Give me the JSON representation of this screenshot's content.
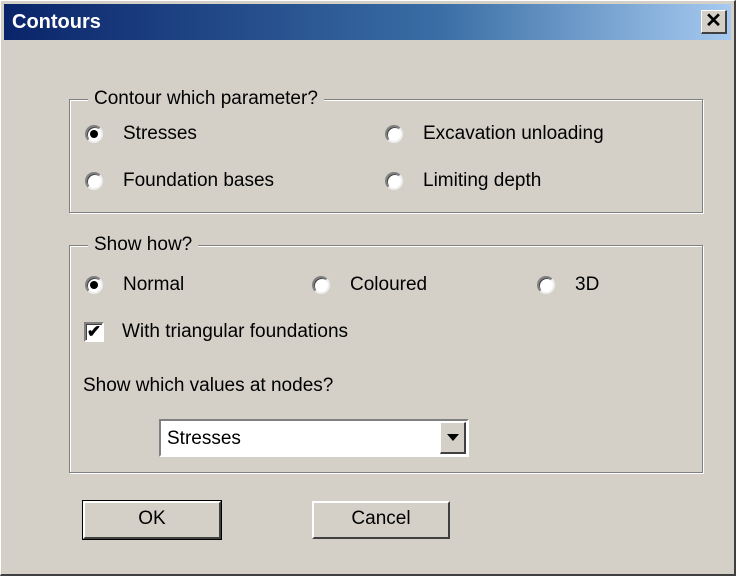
{
  "window": {
    "title": "Contours",
    "close_label": "✕"
  },
  "parameter_group": {
    "legend": "Contour which parameter?",
    "options": [
      {
        "label": "Stresses",
        "selected": true
      },
      {
        "label": "Excavation unloading",
        "selected": false
      },
      {
        "label": "Foundation bases",
        "selected": false
      },
      {
        "label": "Limiting depth",
        "selected": false
      }
    ]
  },
  "show_group": {
    "legend": "Show how?",
    "options": [
      {
        "label": "Normal",
        "selected": true
      },
      {
        "label": "Coloured",
        "selected": false
      },
      {
        "label": "3D",
        "selected": false
      }
    ],
    "triangular": {
      "label": "With triangular foundations",
      "checked": true,
      "mark": "✔"
    },
    "nodes_label": "Show which values at nodes?",
    "nodes_select": {
      "value": "Stresses"
    }
  },
  "buttons": {
    "ok": "OK",
    "cancel": "Cancel"
  }
}
